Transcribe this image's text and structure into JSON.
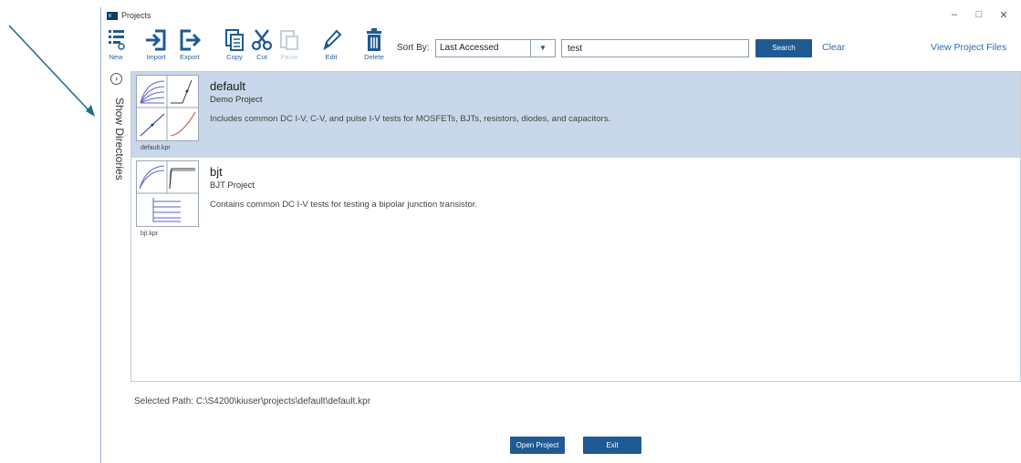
{
  "window": {
    "title": "Projects"
  },
  "toolbar": {
    "new": "New",
    "import": "Import",
    "export": "Export",
    "copy": "Copy",
    "cut": "Cut",
    "paste": "Paste",
    "edit": "Edit",
    "delete": "Delete",
    "sort_label": "Sort By:",
    "sort_value": "Last Accessed",
    "search_value": "test",
    "search_button": "Search",
    "clear": "Clear",
    "view_files": "View Project Files"
  },
  "sidebar": {
    "label": "Show Directories"
  },
  "projects": [
    {
      "name": "default",
      "type": "Demo Project",
      "description": "Includes common DC I-V, C-V, and pulse I-V tests for MOSFETs, BJTs, resistors, diodes, and capacitors.",
      "file": "default.kpr",
      "selected": true
    },
    {
      "name": "bjt",
      "type": "BJT Project",
      "description": "Contains common DC I-V tests for testing a bipolar junction transistor.",
      "file": "bjt.kpr",
      "selected": false
    }
  ],
  "footer": {
    "selected_path": "Selected Path: C:\\S4200\\kiuser\\projects\\default\\default.kpr",
    "open_button": "Open Project",
    "exit_button": "Exit"
  },
  "colors": {
    "accent": "#1f5a93",
    "selection": "#c8d8ea",
    "link": "#2b6cb0"
  }
}
